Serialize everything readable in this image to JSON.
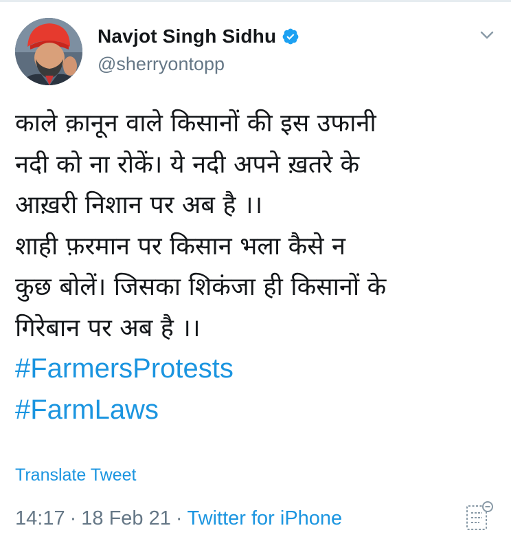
{
  "tweet": {
    "author": {
      "display_name": "Navjot Singh Sidhu",
      "handle": "@sherryontopp",
      "verified_icon": "verified-badge-icon",
      "avatar_icon": "avatar"
    },
    "menu_icon": "chevron-down-icon",
    "text_lines": [
      "काले क़ानून वाले किसानों की इस उफानी",
      "नदी को ना रोकें। ये नदी अपने ख़तरे के",
      "आख़री निशान पर अब है ।।",
      "शाही फ़रमान पर किसान भला कैसे न",
      "कुछ बोलें। जिसका शिकंजा ही किसानों के",
      "गिरेबान पर अब है ।।"
    ],
    "hashtags": [
      "#FarmersProtests",
      "#FarmLaws"
    ],
    "translate_label": "Translate Tweet",
    "time": "14:17",
    "date": "18 Feb 21",
    "separator": "·",
    "source": "Twitter for iPhone",
    "analytics_icon": "analytics-icon"
  },
  "colors": {
    "link": "#1b95e0",
    "text": "#14171a",
    "muted": "#657786",
    "verified": "#1da1f2"
  }
}
